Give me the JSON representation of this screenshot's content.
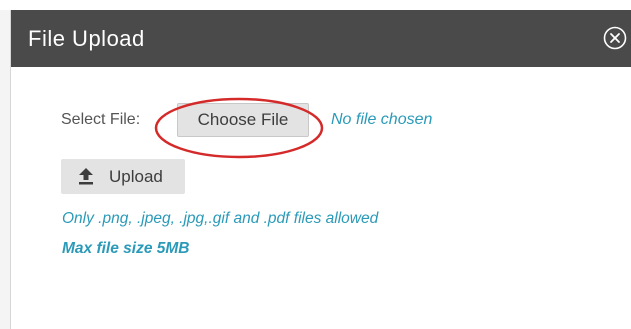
{
  "modal": {
    "title": "File Upload",
    "close_icon": "close-circle-icon"
  },
  "form": {
    "select_label": "Select File:",
    "choose_file_label": "Choose File",
    "no_file_text": "No file chosen",
    "upload_label": "Upload",
    "upload_icon": "upload-arrow-icon"
  },
  "notes": {
    "allowed_types": "Only .png, .jpeg, .jpg,.gif and .pdf files allowed",
    "max_size": "Max file size 5MB"
  },
  "colors": {
    "header_bg": "#4a4a4a",
    "accent_text": "#2a9ab8",
    "button_bg": "#e3e3e3",
    "annotation_ring": "#d42a2a"
  }
}
